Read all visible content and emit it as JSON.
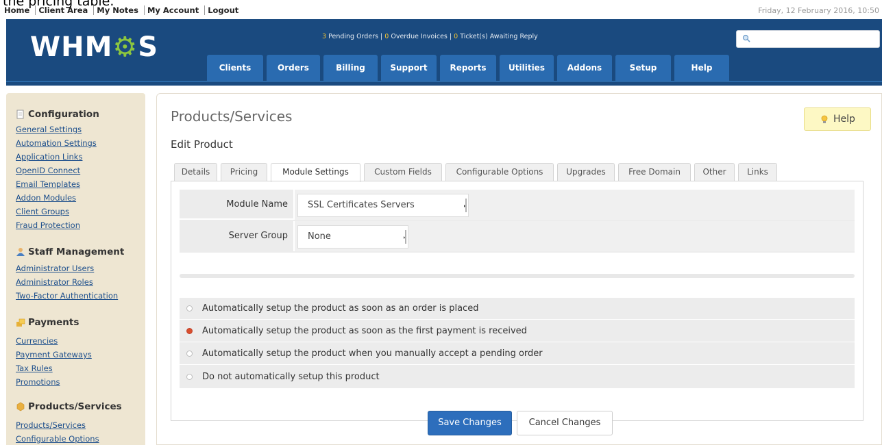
{
  "cutoff_text": "the pricing table.",
  "top_links": [
    "Home",
    "Client Area",
    "My Notes",
    "My Account",
    "Logout"
  ],
  "date": "Friday, 12 February 2016, 10:50",
  "logo": {
    "prefix": "WHM",
    "gear": "⚙",
    "suffix": "S"
  },
  "notifications": {
    "pending_count": "3",
    "pending_label": "Pending Orders",
    "overdue_count": "0",
    "overdue_label": "Overdue Invoices",
    "tickets_count": "0",
    "tickets_label": "Ticket(s) Awaiting Reply",
    "separator": " | "
  },
  "search": {
    "placeholder": "",
    "icon": "search-icon"
  },
  "nav": [
    "Clients",
    "Orders",
    "Billing",
    "Support",
    "Reports",
    "Utilities",
    "Addons",
    "Setup",
    "Help"
  ],
  "sidebar": {
    "configuration": {
      "title": "Configuration",
      "icon": "document-icon",
      "links": [
        "General Settings",
        "Automation Settings",
        "Application Links",
        "OpenID Connect",
        "Email Templates",
        "Addon Modules",
        "Client Groups",
        "Fraud Protection"
      ]
    },
    "staff": {
      "title": "Staff Management",
      "icon": "staff-icon",
      "links": [
        "Administrator Users",
        "Administrator Roles",
        "Two-Factor Authentication"
      ]
    },
    "payments": {
      "title": "Payments",
      "icon": "payments-icon",
      "links": [
        "Currencies",
        "Payment Gateways",
        "Tax Rules",
        "Promotions"
      ]
    },
    "products": {
      "title": "Products/Services",
      "icon": "products-icon",
      "links": [
        "Products/Services",
        "Configurable Options"
      ]
    }
  },
  "main": {
    "title": "Products/Services",
    "help_label": "Help",
    "subtitle": "Edit Product",
    "tabs": [
      "Details",
      "Pricing",
      "Module Settings",
      "Custom Fields",
      "Configurable Options",
      "Upgrades",
      "Free Domain",
      "Other",
      "Links"
    ],
    "active_tab": "Module Settings",
    "module_name_label": "Module Name",
    "module_name_value": "SSL Certificates Servers",
    "server_group_label": "Server Group",
    "server_group_value": "None",
    "radio_options": [
      "Automatically setup the product as soon as an order is placed",
      "Automatically setup the product as soon as the first payment is received",
      "Automatically setup the product when you manually accept a pending order",
      "Do not automatically setup this product"
    ],
    "selected_radio": 1,
    "save_label": "Save Changes",
    "cancel_label": "Cancel Changes"
  },
  "colors": {
    "header": "#1a4a7f",
    "nav_tab": "#2a6bb0",
    "sidebar": "#eee6d2",
    "link": "#1d4f8c",
    "save_button": "#2d6ebc",
    "radio_selected": "#d94e2d",
    "logo_gear": "#8cc63f"
  }
}
